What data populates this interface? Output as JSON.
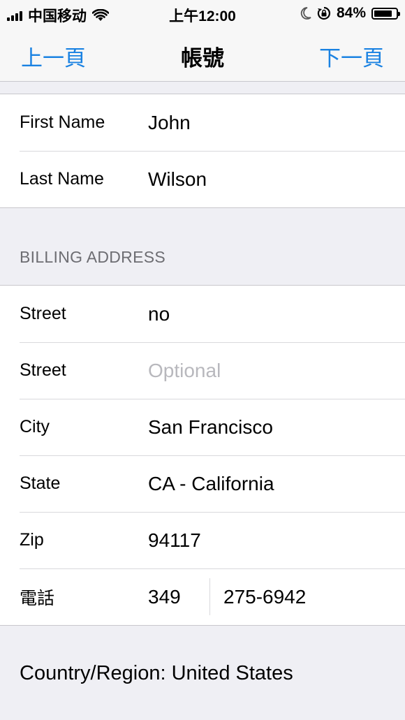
{
  "status_bar": {
    "carrier": "中国移动",
    "time": "上午12:00",
    "battery_percent": "84%",
    "battery_level": 0.84,
    "icons": [
      "signal-icon",
      "wifi-icon",
      "moon-icon",
      "rotation-lock-icon",
      "battery-icon"
    ]
  },
  "nav": {
    "prev_label": "上一頁",
    "title": "帳號",
    "next_label": "下一頁",
    "accent_color": "#1a82e2"
  },
  "name_group": {
    "first_name_label": "First Name",
    "first_name_value": "John",
    "last_name_label": "Last Name",
    "last_name_value": "Wilson"
  },
  "billing": {
    "header": "BILLING ADDRESS",
    "street1_label": "Street",
    "street1_value": "no",
    "street2_label": "Street",
    "street2_placeholder": "Optional",
    "city_label": "City",
    "city_value": "San Francisco",
    "state_label": "State",
    "state_value": "CA - California",
    "zip_label": "Zip",
    "zip_value": "94117",
    "phone_label": "電話",
    "phone_area": "349",
    "phone_number": "275-6942",
    "country_text": "Country/Region: United States"
  }
}
